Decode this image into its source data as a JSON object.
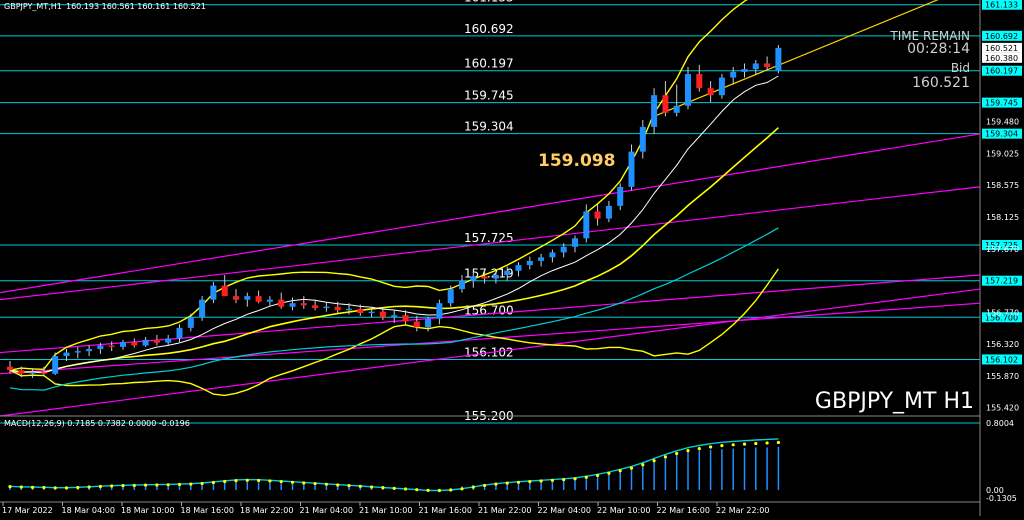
{
  "header": {
    "symbol_line": "GBPJPY_MT,H1",
    "ohlc": "160.193 160.561 160.161 160.521"
  },
  "info": {
    "time_remain_label": "TIME REMAIN",
    "time_remain": "00:28:14",
    "bid_label": "Bid",
    "bid": "160.521",
    "highlight_price": "159.098"
  },
  "watermark": "GBPJPY_MT H1",
  "macd": {
    "label": "MACD(12,26,9) 0.7185 0.7382 0.0000 -0.0196",
    "axis_top": "0.8004",
    "axis_zero": "0.00",
    "axis_bottom": "-0.1305"
  },
  "colors": {
    "background": "#000000",
    "bull_candle": "#1e90ff",
    "bear_candle": "#ff2020",
    "level_line": "#00c8d8",
    "bands": "#ffff00",
    "channel": "#ff00ff",
    "ma_white": "#ffffff",
    "ma_cyan": "#00ced1",
    "macd_signal": "#ffff00",
    "macd_line": "#00ced1",
    "price_tag_bg": "#00ffff"
  },
  "chart_data": {
    "type": "candlestick",
    "symbol": "GBPJPY_MT",
    "timeframe": "H1",
    "ylim": [
      155.3,
      161.2
    ],
    "y_ticks": [
      "159.480",
      "159.025",
      "158.575",
      "158.125",
      "157.670",
      "156.770",
      "156.320",
      "155.870",
      "155.420"
    ],
    "x_ticks": [
      "17 Mar 2022",
      "18 Mar 04:00",
      "18 Mar 10:00",
      "18 Mar 16:00",
      "18 Mar 22:00",
      "21 Mar 04:00",
      "21 Mar 10:00",
      "21 Mar 16:00",
      "21 Mar 22:00",
      "22 Mar 04:00",
      "22 Mar 10:00",
      "22 Mar 16:00",
      "22 Mar 22:00"
    ],
    "levels": [
      {
        "label": "161.133",
        "value": 161.133,
        "tag": "161.133"
      },
      {
        "label": "160.692",
        "value": 160.692,
        "tag": "160.692"
      },
      {
        "label": "160.197",
        "value": 160.197,
        "tag": "160.197"
      },
      {
        "label": "159.745",
        "value": 159.745,
        "tag": "159.745"
      },
      {
        "label": "159.304",
        "value": 159.304,
        "tag": "159.304"
      },
      {
        "label": "157.725",
        "value": 157.725,
        "tag": "157.725"
      },
      {
        "label": "157.219",
        "value": 157.219,
        "tag": "157.219"
      },
      {
        "label": "156.700",
        "value": 156.7,
        "tag": "156.700"
      },
      {
        "label": "156.102",
        "value": 156.102,
        "tag": "156.102"
      },
      {
        "label": "155.200",
        "value": 155.2,
        "tag": ""
      }
    ],
    "price_tags": [
      "160.521",
      "160.380"
    ],
    "ohlc": [
      [
        156.0,
        156.08,
        155.9,
        155.95
      ],
      [
        155.95,
        156.0,
        155.85,
        155.9
      ],
      [
        155.9,
        155.98,
        155.84,
        155.92
      ],
      [
        155.92,
        156.0,
        155.86,
        155.9
      ],
      [
        155.9,
        156.2,
        155.88,
        156.15
      ],
      [
        156.15,
        156.25,
        156.08,
        156.2
      ],
      [
        156.2,
        156.28,
        156.12,
        156.22
      ],
      [
        156.22,
        156.3,
        156.15,
        156.25
      ],
      [
        156.25,
        156.34,
        156.18,
        156.3
      ],
      [
        156.3,
        156.36,
        156.22,
        156.28
      ],
      [
        156.28,
        156.38,
        156.24,
        156.35
      ],
      [
        156.35,
        156.4,
        156.27,
        156.3
      ],
      [
        156.3,
        156.42,
        156.28,
        156.38
      ],
      [
        156.38,
        156.45,
        156.3,
        156.34
      ],
      [
        156.34,
        156.45,
        156.3,
        156.4
      ],
      [
        156.4,
        156.6,
        156.35,
        156.55
      ],
      [
        156.55,
        156.75,
        156.5,
        156.7
      ],
      [
        156.7,
        157.0,
        156.65,
        156.95
      ],
      [
        156.95,
        157.2,
        156.9,
        157.15
      ],
      [
        157.15,
        157.3,
        157.05,
        157.0
      ],
      [
        157.0,
        157.1,
        156.9,
        156.95
      ],
      [
        156.95,
        157.05,
        156.85,
        157.0
      ],
      [
        157.0,
        157.08,
        156.9,
        156.92
      ],
      [
        156.92,
        157.0,
        156.85,
        156.95
      ],
      [
        156.95,
        157.05,
        156.82,
        156.85
      ],
      [
        156.85,
        156.98,
        156.8,
        156.9
      ],
      [
        156.9,
        157.0,
        156.82,
        156.87
      ],
      [
        156.87,
        156.95,
        156.8,
        156.83
      ],
      [
        156.83,
        156.92,
        156.78,
        156.85
      ],
      [
        156.85,
        156.92,
        156.76,
        156.8
      ],
      [
        156.8,
        156.9,
        156.74,
        156.82
      ],
      [
        156.82,
        156.88,
        156.72,
        156.76
      ],
      [
        156.76,
        156.85,
        156.7,
        156.78
      ],
      [
        156.78,
        156.84,
        156.66,
        156.7
      ],
      [
        156.7,
        156.8,
        156.62,
        156.73
      ],
      [
        156.73,
        156.8,
        156.6,
        156.64
      ],
      [
        156.64,
        156.72,
        156.5,
        156.56
      ],
      [
        156.56,
        156.7,
        156.5,
        156.68
      ],
      [
        156.68,
        156.95,
        156.6,
        156.9
      ],
      [
        156.9,
        157.15,
        156.85,
        157.1
      ],
      [
        157.1,
        157.3,
        157.05,
        157.22
      ],
      [
        157.22,
        157.35,
        157.12,
        157.28
      ],
      [
        157.28,
        157.36,
        157.18,
        157.25
      ],
      [
        157.25,
        157.35,
        157.18,
        157.3
      ],
      [
        157.3,
        157.42,
        157.22,
        157.36
      ],
      [
        157.36,
        157.48,
        157.28,
        157.44
      ],
      [
        157.44,
        157.56,
        157.38,
        157.5
      ],
      [
        157.5,
        157.6,
        157.42,
        157.55
      ],
      [
        157.55,
        157.66,
        157.48,
        157.62
      ],
      [
        157.62,
        157.75,
        157.55,
        157.7
      ],
      [
        157.7,
        157.86,
        157.62,
        157.82
      ],
      [
        157.82,
        158.3,
        157.76,
        158.2
      ],
      [
        158.2,
        158.3,
        158.0,
        158.1
      ],
      [
        158.1,
        158.35,
        158.05,
        158.28
      ],
      [
        158.28,
        158.6,
        158.22,
        158.55
      ],
      [
        158.55,
        159.15,
        158.5,
        159.05
      ],
      [
        159.05,
        159.5,
        158.95,
        159.4
      ],
      [
        159.4,
        159.95,
        159.3,
        159.85
      ],
      [
        159.85,
        160.05,
        159.55,
        159.6
      ],
      [
        159.6,
        160.0,
        159.55,
        159.7
      ],
      [
        159.7,
        160.25,
        159.65,
        160.15
      ],
      [
        160.15,
        160.28,
        159.9,
        159.95
      ],
      [
        159.95,
        160.05,
        159.75,
        159.85
      ],
      [
        159.85,
        160.15,
        159.8,
        160.1
      ],
      [
        160.1,
        160.25,
        160.0,
        160.18
      ],
      [
        160.18,
        160.3,
        160.1,
        160.22
      ],
      [
        160.22,
        160.35,
        160.15,
        160.3
      ],
      [
        160.3,
        160.4,
        160.2,
        160.25
      ],
      [
        160.193,
        160.561,
        160.161,
        160.521
      ]
    ],
    "macd_hist": [
      0.05,
      0.04,
      0.03,
      0.03,
      0.03,
      0.04,
      0.05,
      0.06,
      0.06,
      0.07,
      0.07,
      0.07,
      0.08,
      0.08,
      0.08,
      0.09,
      0.1,
      0.12,
      0.14,
      0.15,
      0.15,
      0.14,
      0.13,
      0.12,
      0.11,
      0.1,
      0.09,
      0.08,
      0.07,
      0.06,
      0.05,
      0.04,
      0.03,
      0.02,
      0.01,
      0.0,
      -0.01,
      -0.02,
      0.0,
      0.03,
      0.06,
      0.08,
      0.1,
      0.11,
      0.12,
      0.13,
      0.14,
      0.15,
      0.16,
      0.17,
      0.19,
      0.24,
      0.27,
      0.3,
      0.34,
      0.4,
      0.47,
      0.54,
      0.57,
      0.6,
      0.64,
      0.66,
      0.67,
      0.68,
      0.69,
      0.7,
      0.71,
      0.71,
      0.72
    ]
  }
}
